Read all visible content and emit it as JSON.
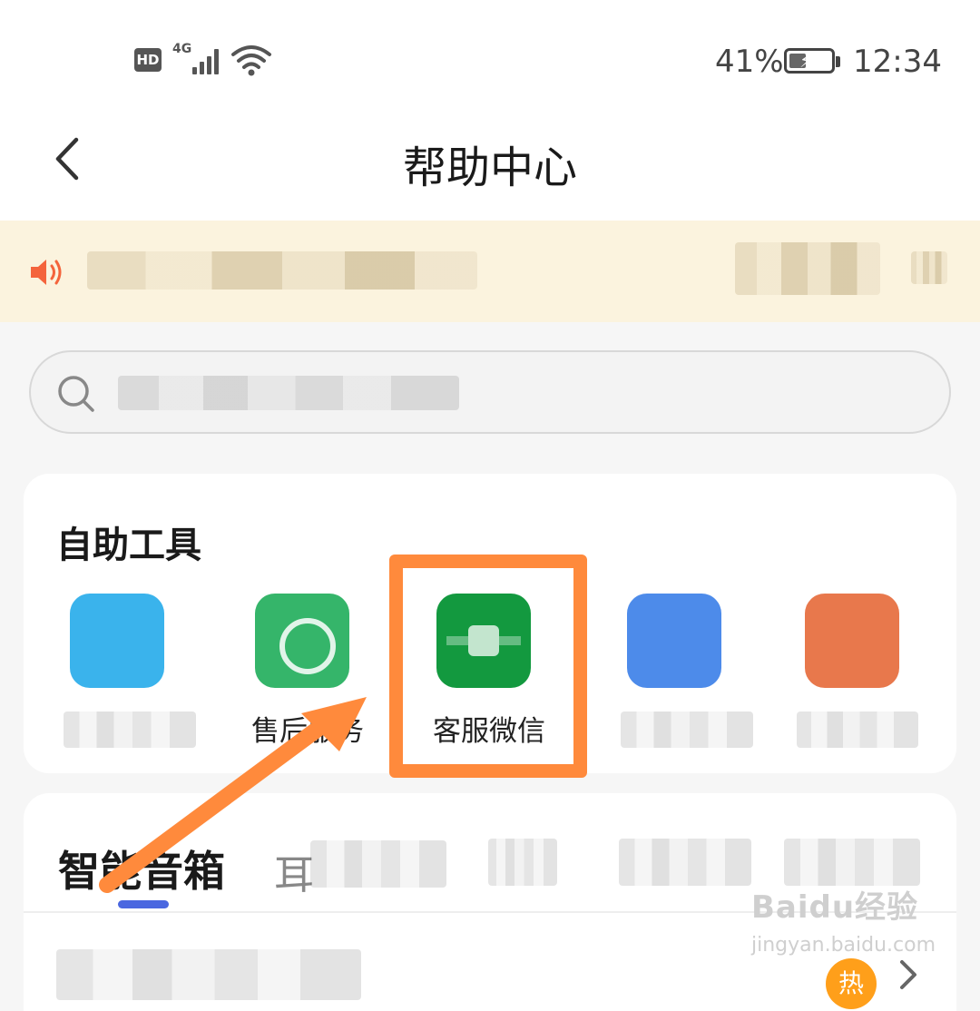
{
  "status_bar": {
    "hd": "HD",
    "network": "4G",
    "battery_percent": "41%",
    "battery_level": 0.41,
    "time": "12:34"
  },
  "header": {
    "title": "帮助中心",
    "back_icon": "chevron-left-icon"
  },
  "notice": {
    "icon": "speaker-icon"
  },
  "search": {
    "icon": "search-icon",
    "placeholder": ""
  },
  "self_service": {
    "title": "自助工具",
    "tools": [
      {
        "label": "",
        "color": "#3ab3ec"
      },
      {
        "label": "售后服务",
        "color": "#35b56a"
      },
      {
        "label": "客服微信",
        "color": "#13993f"
      },
      {
        "label": "",
        "color": "#4d8bea"
      },
      {
        "label": "",
        "color": "#e8784c"
      }
    ]
  },
  "categories": {
    "active_tab": "智能音箱",
    "other_tab_fragment": "耳",
    "hot_badge": "热",
    "accent": "#4a67e0"
  },
  "colors": {
    "highlight": "#ff8a3c",
    "notice_bg": "#fbf3de"
  },
  "watermark": {
    "brand": "Baidu经验",
    "url": "jingyan.baidu.com"
  }
}
